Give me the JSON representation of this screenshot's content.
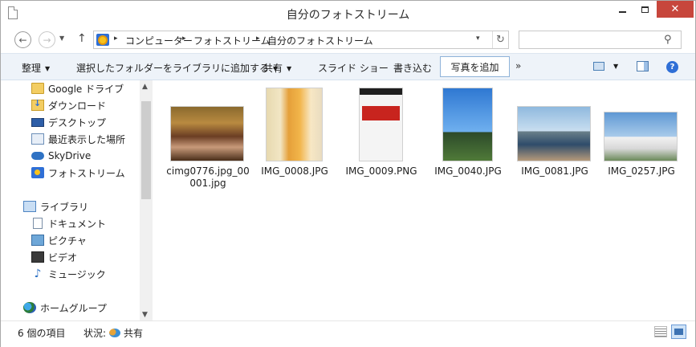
{
  "window": {
    "title": "自分のフォトストリーム",
    "close_glyph": "✕"
  },
  "address_bar": {
    "breadcrumbs": [
      "コンピューター",
      "フォトストリーム",
      "自分のフォトストリーム"
    ],
    "separator": "▸",
    "search_placeholder": ""
  },
  "command_bar": {
    "organize": "整理",
    "add_to_library": "選択したフォルダーをライブラリに追加する",
    "share": "共有",
    "slideshow": "スライド ショー",
    "burn": "書き込む",
    "add_photos": "写真を追加",
    "more": "»"
  },
  "nav_pane": {
    "favorites": [
      {
        "label": "Google ドライブ",
        "icon": "folder-icon"
      },
      {
        "label": "ダウンロード",
        "icon": "downloads-icon"
      },
      {
        "label": "デスクトップ",
        "icon": "desktop-icon"
      },
      {
        "label": "最近表示した場所",
        "icon": "recent-places-icon"
      },
      {
        "label": "SkyDrive",
        "icon": "skydrive-icon"
      },
      {
        "label": "フォトストリーム",
        "icon": "photostream-icon"
      }
    ],
    "libraries_label": "ライブラリ",
    "libraries": [
      {
        "label": "ドキュメント",
        "icon": "documents-icon"
      },
      {
        "label": "ピクチャ",
        "icon": "pictures-icon"
      },
      {
        "label": "ビデオ",
        "icon": "video-icon"
      },
      {
        "label": "ミュージック",
        "icon": "music-icon"
      }
    ],
    "homegroup_label": "ホームグループ"
  },
  "files": [
    {
      "name": "cimg0776.jpg_00001.jpg",
      "thumb": "party-photo"
    },
    {
      "name": "IMG_0008.JPG",
      "thumb": "bottle-photo"
    },
    {
      "name": "IMG_0009.PNG",
      "thumb": "phone-screenshot"
    },
    {
      "name": "IMG_0040.JPG",
      "thumb": "palm-tree-photo"
    },
    {
      "name": "IMG_0081.JPG",
      "thumb": "pool-photo"
    },
    {
      "name": "IMG_0257.JPG",
      "thumb": "church-photo"
    }
  ],
  "status_bar": {
    "item_count": "6 個の項目",
    "state_label": "状況:",
    "state_value": "共有"
  },
  "colors": {
    "close_button": "#c7463c",
    "command_bar_bg": "#eef3f9",
    "accent": "#2f6fd6"
  }
}
